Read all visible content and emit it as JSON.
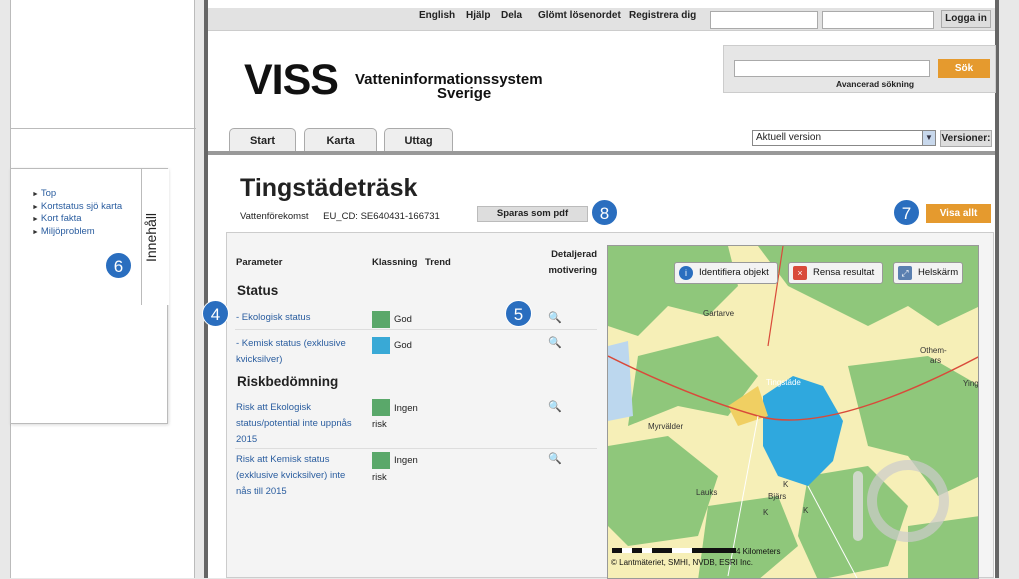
{
  "topbar": {
    "links": [
      "English",
      "Hjälp",
      "Dela",
      "Glömt lösenordet",
      "Registrera dig"
    ],
    "login_label": "Logga in"
  },
  "header": {
    "logo": "VISS",
    "logo_line1": "Vatteninformationssystem",
    "logo_line2": "Sverige",
    "search_button": "Sök",
    "advanced_search": "Avancerad sökning"
  },
  "nav": {
    "tabs": [
      "Start",
      "Karta",
      "Uttag"
    ],
    "version_value": "Aktuell version",
    "versions_label": "Versioner:"
  },
  "toc": {
    "items": [
      "Top",
      "Kortstatus sjö karta",
      "Kort fakta",
      "Miljöproblem"
    ],
    "tab_label": "Innehåll"
  },
  "page": {
    "title": "Tingstädeträsk",
    "type": "Vattenförekomst",
    "eu_cd": "EU_CD: SE640431-166731",
    "pdf_button": "Sparas som pdf",
    "show_all_button": "Visa allt"
  },
  "table": {
    "headers": {
      "parameter": "Parameter",
      "klassning": "Klassning",
      "trend": "Trend",
      "detaljerad_1": "Detaljerad",
      "detaljerad_2": "motivering"
    },
    "sections": {
      "status": "Status",
      "risk": "Riskbedömning"
    },
    "rows": [
      {
        "param_1": "- Ekologisk status",
        "value": "God",
        "color": "#5aa86a"
      },
      {
        "param_1": "- Kemisk status (exklusive",
        "param_2": "kvicksilver)",
        "value": "God",
        "color": "#39a9d6"
      },
      {
        "param_1": "Risk att Ekologisk",
        "param_2": "status/potential inte uppnås",
        "param_3": "2015",
        "value_1": "Ingen",
        "value_2": "risk",
        "color": "#5aa86a"
      },
      {
        "param_1": "Risk att Kemisk status",
        "param_2": "(exklusive kvicksilver) inte",
        "param_3": "nås till 2015",
        "value_1": "Ingen",
        "value_2": "risk",
        "color": "#5aa86a"
      }
    ]
  },
  "map": {
    "identify_button": "Identifiera objekt",
    "clear_button": "Rensa resultat",
    "fullscreen_button": "Helskärm",
    "labels": [
      "Gartarve",
      "Othem-",
      "ars",
      "Tingstäde",
      "Myrvälder",
      "Lauks",
      "Bjärs",
      "Ying",
      "K",
      "K",
      "K"
    ],
    "scale_label": "4 Kilometers",
    "copyright": "© Lantmäteriet, SMHI, NVDB, ESRI Inc."
  },
  "badges": [
    "4",
    "5",
    "6",
    "7",
    "8"
  ]
}
